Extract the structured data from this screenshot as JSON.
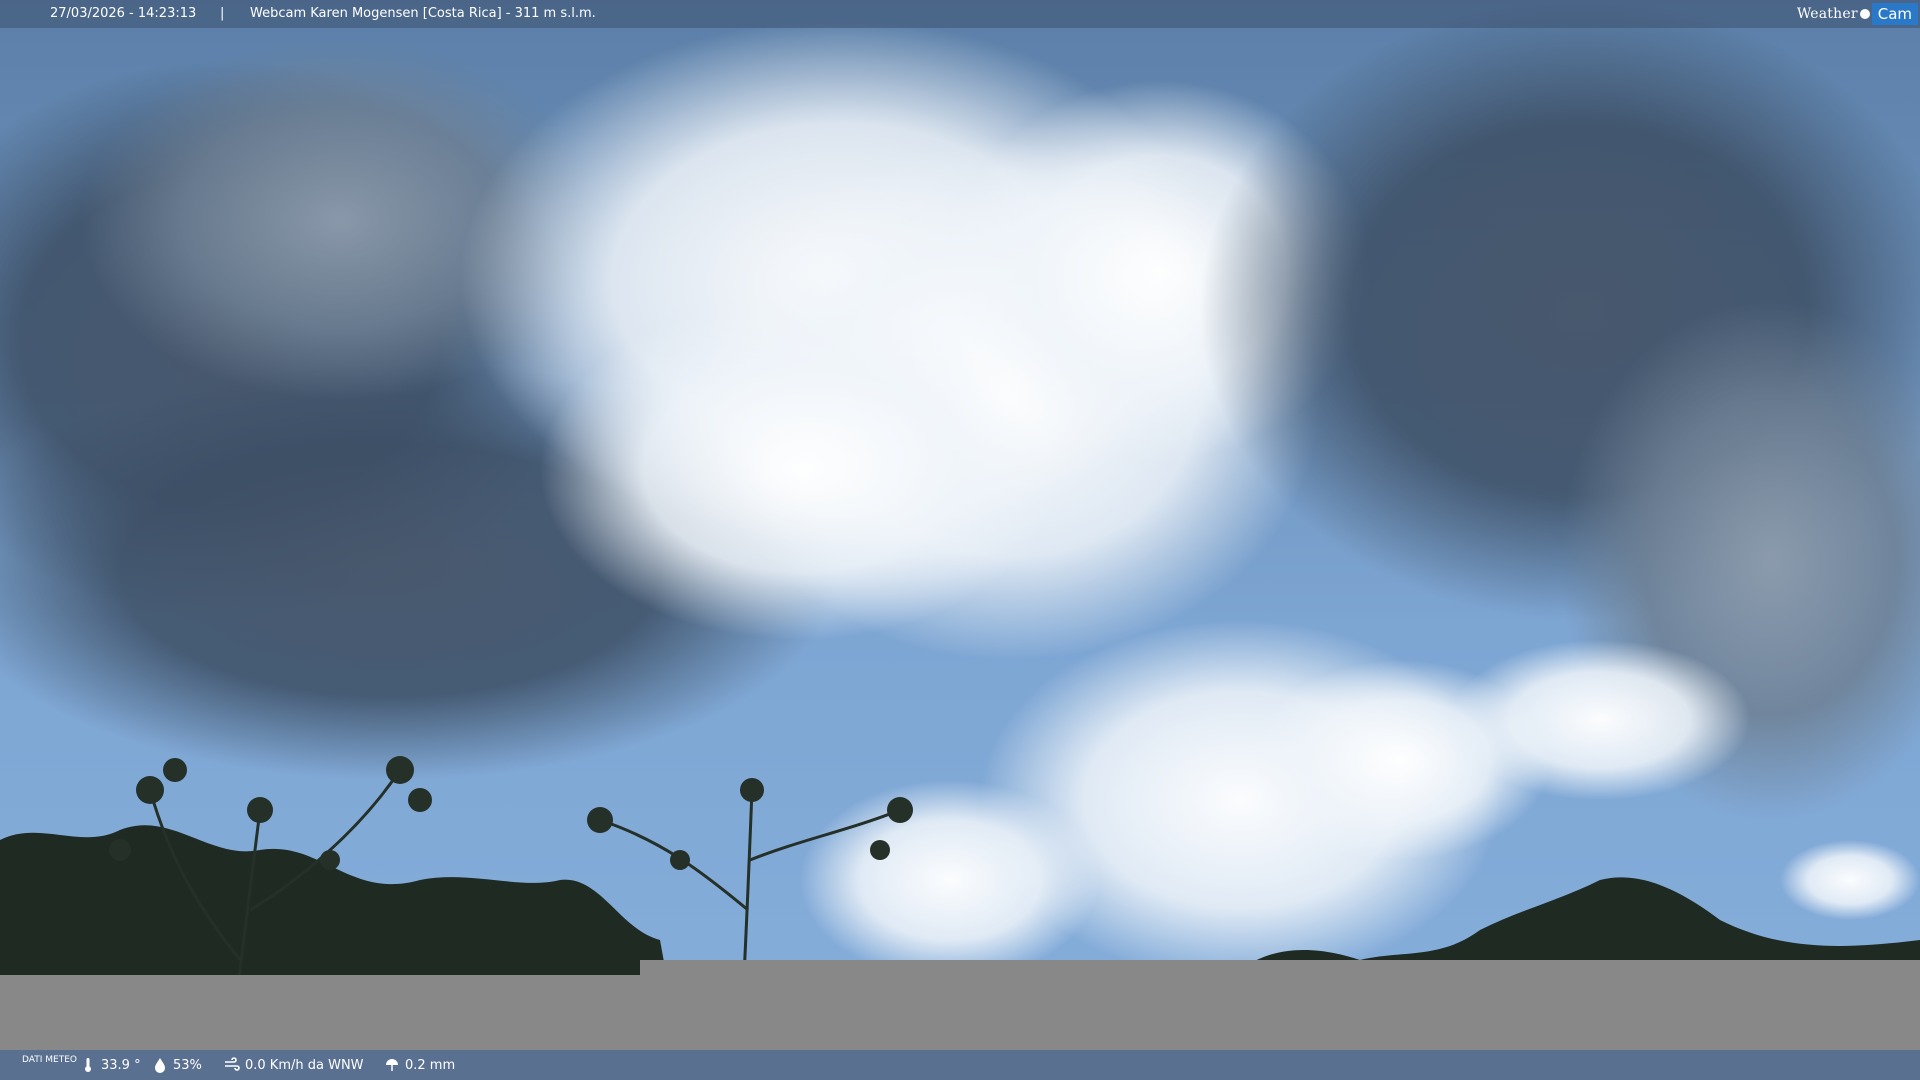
{
  "header": {
    "datetime": "27/03/2026 - 14:23:13",
    "separator": "|",
    "title": "Webcam Karen Mogensen [Costa Rica]  - 311 m s.l.m.",
    "logo_text_1": "Weather",
    "logo_text_2": "Cam"
  },
  "weather_bar": {
    "label": "DATI METEO",
    "temperature": "33.9 °",
    "humidity": "53%",
    "wind": "0.0 Km/h da WNW",
    "rain": "0.2 mm"
  },
  "icons": [
    "thermometer-icon",
    "humidity-icon",
    "wind-icon",
    "rain-icon"
  ],
  "colors": {
    "topbar_bg": "#3c506e",
    "bottombar_bg": "#5a7090",
    "logo_accent": "#2a78c8",
    "gray_band": "#888888"
  }
}
